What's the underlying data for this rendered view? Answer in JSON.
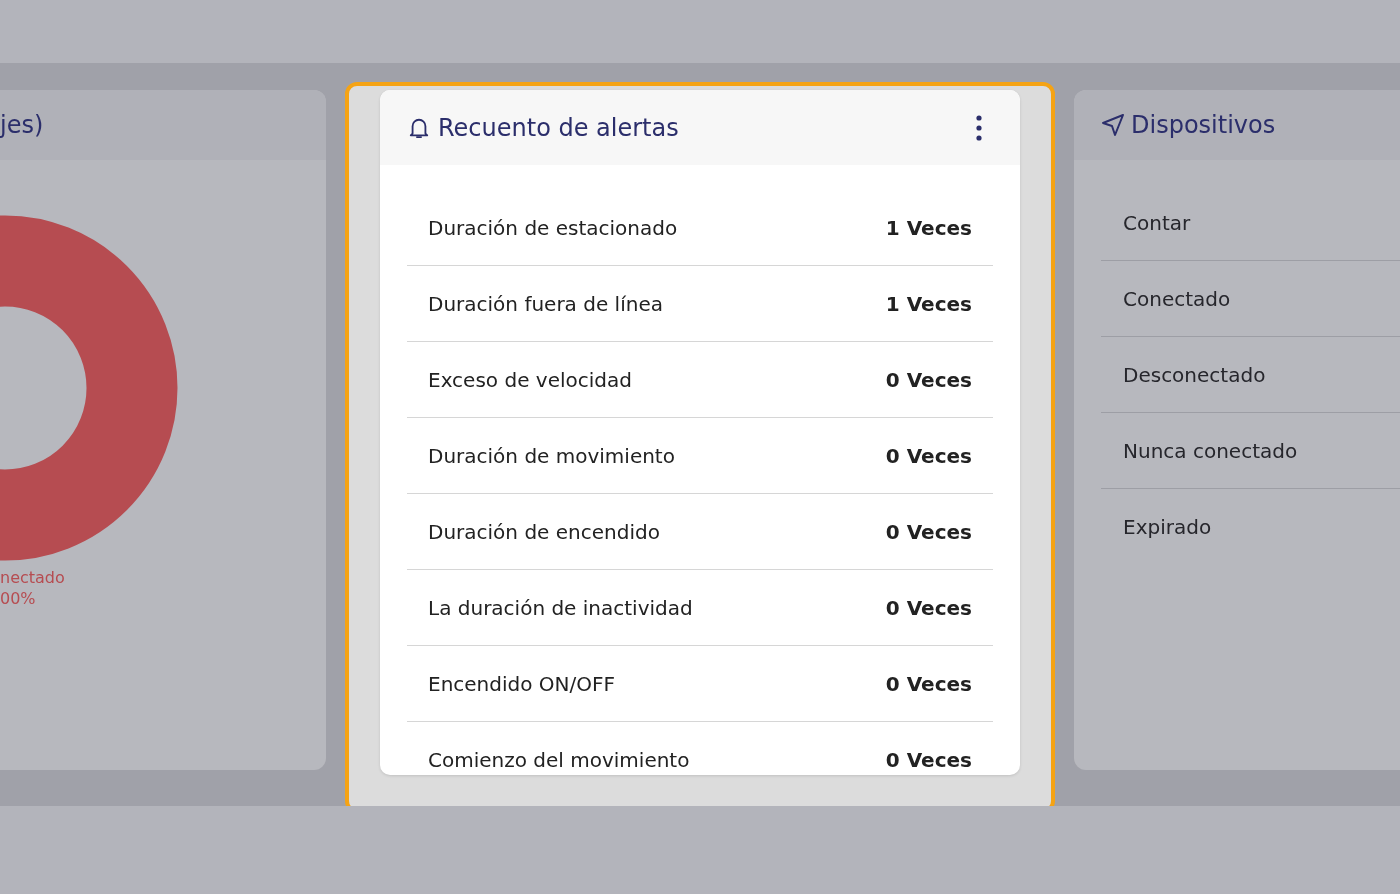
{
  "left_card": {
    "title": "jes)",
    "legend": [
      {
        "label": "nectado",
        "value": "00%",
        "color": "#b64c51"
      }
    ]
  },
  "alerts_card": {
    "title": "Recuento de alertas",
    "rows": [
      {
        "label": "Duración de estacionado",
        "value": "1 Veces"
      },
      {
        "label": "Duración fuera de línea",
        "value": "1 Veces"
      },
      {
        "label": "Exceso de velocidad",
        "value": "0 Veces"
      },
      {
        "label": "Duración de movimiento",
        "value": "0 Veces"
      },
      {
        "label": "Duración de encendido",
        "value": "0 Veces"
      },
      {
        "label": "La duración de inactividad",
        "value": "0 Veces"
      },
      {
        "label": "Encendido ON/OFF",
        "value": "0 Veces"
      },
      {
        "label": "Comienzo del movimiento",
        "value": "0 Veces"
      }
    ]
  },
  "devices_card": {
    "title": "Dispositivos",
    "rows": [
      "Contar",
      "Conectado",
      "Desconectado",
      "Nunca conectado",
      "Expirado"
    ]
  }
}
